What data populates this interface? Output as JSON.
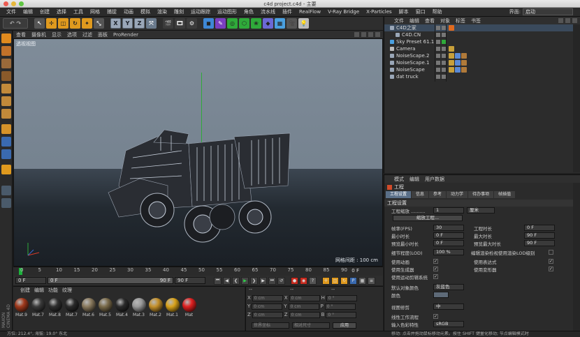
{
  "window": {
    "title": "c4d project.c4d - 主要"
  },
  "menubar": {
    "items": [
      "文件",
      "编辑",
      "创建",
      "选择",
      "工具",
      "网格",
      "捕捉",
      "动画",
      "模拟",
      "渲染",
      "雕刻",
      "运动跟踪",
      "运动图形",
      "角色",
      "流水线",
      "插件",
      "RealFlow",
      "V-Ray Bridge",
      "X-Particles",
      "脚本",
      "窗口",
      "帮助"
    ],
    "interface_label": "界面:",
    "interface_value": "启动"
  },
  "toolbar": {
    "axis_x": "X",
    "axis_y": "Y",
    "axis_z": "Z"
  },
  "viewport": {
    "menu": [
      "查看",
      "摄像机",
      "显示",
      "选项",
      "过滤",
      "面板",
      "ProRender"
    ],
    "label": "透视视图",
    "grid_spacing": "网格间距 : 100 cm"
  },
  "timeline": {
    "ticks": [
      "0",
      "5",
      "10",
      "15",
      "20",
      "25",
      "30",
      "35",
      "40",
      "45",
      "50",
      "55",
      "60",
      "65",
      "70",
      "75",
      "80",
      "85",
      "90"
    ],
    "current_frame": "0 F"
  },
  "playbar": {
    "start": "0 F",
    "preview_start": "0 F",
    "preview_end": "90 F",
    "end": "90 F"
  },
  "materials": {
    "menu": [
      "创建",
      "编辑",
      "功能",
      "纹理"
    ],
    "items": [
      {
        "name": "Mat.9",
        "color": "#a0391c"
      },
      {
        "name": "Mat.7",
        "color": "#3a3a3a"
      },
      {
        "name": "Mat.8",
        "color": "#2f2f2f"
      },
      {
        "name": "Mat.7",
        "color": "#2a2a2a"
      },
      {
        "name": "Mat.6",
        "color": "#8a7a5e"
      },
      {
        "name": "Mat.5",
        "color": "#7a6b4a"
      },
      {
        "name": "Mat.4",
        "color": "#2b2b2b"
      },
      {
        "name": "Mat.3",
        "color": "#9a9a9a"
      },
      {
        "name": "Mat.2",
        "color": "#c4902a"
      },
      {
        "name": "Mat.1",
        "color": "#d9a21a"
      },
      {
        "name": "Mat",
        "color": "#e02020"
      }
    ]
  },
  "coords": {
    "headers": [
      "--",
      "--",
      "--"
    ],
    "rows": [
      {
        "a": "X",
        "av": "0 cm",
        "b": "X",
        "bv": "0 cm",
        "c": "H",
        "cv": "0 °"
      },
      {
        "a": "Y",
        "av": "0 cm",
        "b": "Y",
        "bv": "0 cm",
        "c": "P",
        "cv": "0 °"
      },
      {
        "a": "Z",
        "av": "0 cm",
        "b": "Z",
        "bv": "0 cm",
        "c": "B",
        "cv": "0 °"
      }
    ],
    "mode": "世界坐标",
    "scale": "相对尺寸",
    "apply": "应用"
  },
  "status": {
    "text": "方位: 212.4°, 海拔: 19.0° 东北",
    "hint": "移动: 点击并拖动鼠标移动元素。按住 SHIFT 键量化移动; 节点编辑模式时"
  },
  "object_manager": {
    "menu": [
      "文件",
      "编辑",
      "查看",
      "对象",
      "标签",
      "书签"
    ],
    "objects": [
      {
        "name": "C4D之家",
        "indent": 0,
        "icon": "#9aa7b8"
      },
      {
        "name": "C4D.CN",
        "indent": 1,
        "icon": "#9aa7b8"
      },
      {
        "name": "Sky Preset 61.1",
        "indent": 0,
        "icon": "#4aa0e0"
      },
      {
        "name": "Camera",
        "indent": 0,
        "icon": "#bbbbbb"
      },
      {
        "name": "NoiseScape.2",
        "indent": 0,
        "icon": "#9aa7b8"
      },
      {
        "name": "NoiseScape.1",
        "indent": 0,
        "icon": "#9aa7b8"
      },
      {
        "name": "NoiseScape",
        "indent": 0,
        "icon": "#9aa7b8"
      },
      {
        "name": "dat truck",
        "indent": 0,
        "icon": "#9aa7b8"
      }
    ]
  },
  "attributes": {
    "menu": [
      "模式",
      "编辑",
      "用户数据"
    ],
    "object_title": "工程",
    "tabs": [
      "工程设置",
      "信息",
      "参考",
      "动力学",
      "待办事项",
      "帧插值"
    ],
    "section": "工程设置",
    "scale_label": "工程缩放 ..........",
    "scale_value": "1",
    "scale_unit": "厘米",
    "scale_button": "缩放工程...",
    "left_fields": [
      {
        "label": "帧率(FPS)",
        "value": "30"
      },
      {
        "label": "最小时长",
        "value": "0 F"
      },
      {
        "label": "预览最小时长",
        "value": "0 F"
      }
    ],
    "right_fields": [
      {
        "label": "工程时长",
        "value": "0 F"
      },
      {
        "label": "最大时长",
        "value": "90 F"
      },
      {
        "label": "预览最大时长",
        "value": "90 F"
      }
    ],
    "lod_label": "细节程度(LOD)",
    "lod_value": "100 %",
    "lod_render": "编辑渲染检视使用渲染LOD级别",
    "checks_left": [
      "使用动画",
      "使用生成器",
      "使用运动剪辑系统"
    ],
    "checks_right": [
      "使用表达式",
      "使用变形器"
    ],
    "default_color_label": "默认对象颜色",
    "default_color_value": "灰蓝色",
    "color_label": "颜色",
    "view_clip_label": "视图修剪",
    "view_clip_value": "中",
    "linear_label": "线性工作流程",
    "input_color_label": "输入色彩特性",
    "input_color_value": "sRGB"
  }
}
